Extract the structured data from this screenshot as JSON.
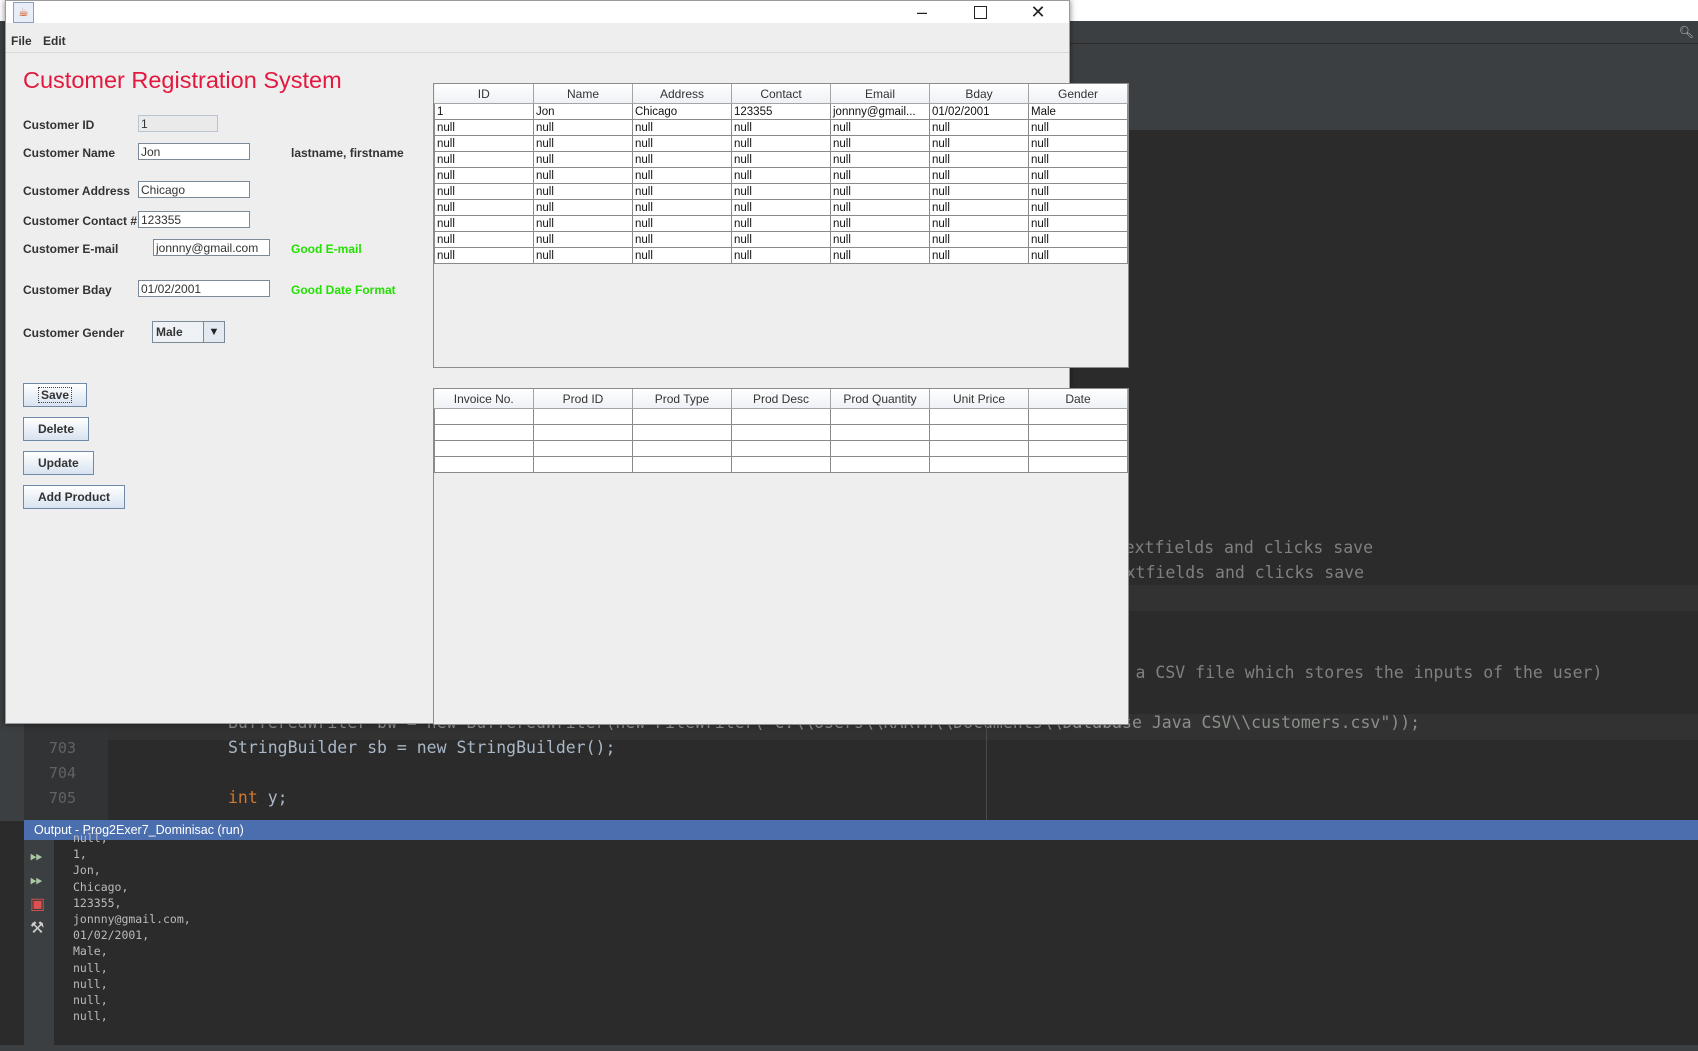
{
  "window": {
    "menu": [
      "File",
      "Edit"
    ]
  },
  "form": {
    "title": "Customer Registration System",
    "labels": {
      "id": "Customer ID",
      "name": "Customer Name",
      "address": "Customer Address",
      "contact": "Customer Contact #",
      "email": "Customer E-mail",
      "bday": "Customer Bday",
      "gender": "Customer Gender"
    },
    "values": {
      "id": "1",
      "name": "Jon",
      "address": "Chicago",
      "contact": "123355",
      "email": "jonnny@gmail.com",
      "bday": "01/02/2001",
      "gender": "Male"
    },
    "name_hint": "lastname, firstname",
    "email_status": "Good E-mail",
    "bday_status": "Good Date Format",
    "buttons": {
      "save": "Save",
      "delete": "Delete",
      "update": "Update",
      "add_product": "Add Product"
    }
  },
  "customers_table": {
    "columns": [
      "ID",
      "Name",
      "Address",
      "Contact",
      "Email",
      "Bday",
      "Gender"
    ],
    "rows": [
      [
        "1",
        "Jon",
        "Chicago",
        "123355",
        "jonnny@gmail...",
        "01/02/2001",
        "Male"
      ],
      [
        "null",
        "null",
        "null",
        "null",
        "null",
        "null",
        "null"
      ],
      [
        "null",
        "null",
        "null",
        "null",
        "null",
        "null",
        "null"
      ],
      [
        "null",
        "null",
        "null",
        "null",
        "null",
        "null",
        "null"
      ],
      [
        "null",
        "null",
        "null",
        "null",
        "null",
        "null",
        "null"
      ],
      [
        "null",
        "null",
        "null",
        "null",
        "null",
        "null",
        "null"
      ],
      [
        "null",
        "null",
        "null",
        "null",
        "null",
        "null",
        "null"
      ],
      [
        "null",
        "null",
        "null",
        "null",
        "null",
        "null",
        "null"
      ],
      [
        "null",
        "null",
        "null",
        "null",
        "null",
        "null",
        "null"
      ],
      [
        "null",
        "null",
        "null",
        "null",
        "null",
        "null",
        "null"
      ]
    ]
  },
  "products_table": {
    "columns": [
      "Invoice No.",
      "Prod ID",
      "Prod Type",
      "Prod Desc",
      "Prod Quantity",
      "Unit Price",
      "Date"
    ],
    "rows": [
      [
        "",
        "",
        "",
        "",
        "",
        "",
        ""
      ],
      [
        "",
        "",
        "",
        "",
        "",
        "",
        ""
      ],
      [
        "",
        "",
        "",
        "",
        "",
        "",
        ""
      ],
      [
        "",
        "",
        "",
        "",
        "",
        "",
        ""
      ]
    ]
  },
  "editor": {
    "comment1": "the textfields and clicks save",
    "comment2": "the textfields and clicks save",
    "comment3": "reates a CSV file which stores the inputs of the user)",
    "line702_text": "BufferedWriter bw = new BufferedWriter(new FileWriter(\"C:\\\\Users\\\\KARTH\\\\Documents\\\\Database Java CSV\\\\customers.csv\"));",
    "line703": {
      "number": "703",
      "text": "StringBuilder sb = new StringBuilder();"
    },
    "line704": {
      "number": "704"
    },
    "line705": {
      "number": "705",
      "text_kw": "int",
      "text_rest": " y;"
    }
  },
  "output": {
    "title": "Output - Prog2Exer7_Dominisac (run)",
    "lines": [
      "null,",
      "1,",
      "Jon,",
      "Chicago,",
      "123355,",
      "jonnny@gmail.com,",
      "01/02/2001,",
      "Male,",
      "null,",
      "null,",
      "null,",
      "null,"
    ]
  }
}
